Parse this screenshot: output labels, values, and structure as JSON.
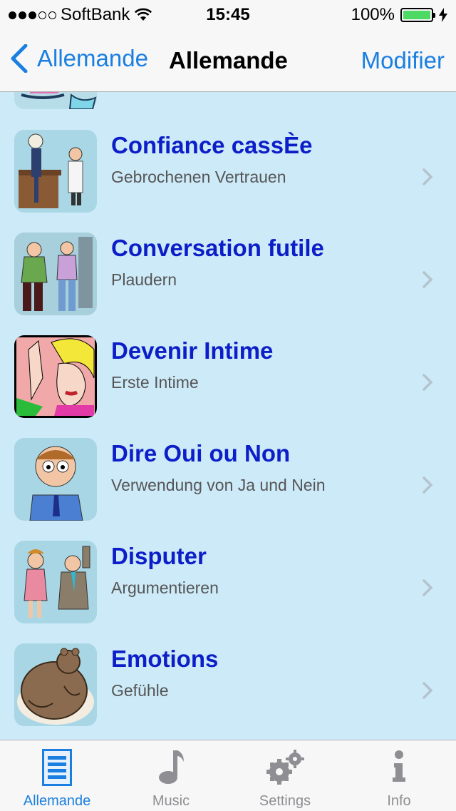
{
  "status_bar": {
    "carrier": "SoftBank",
    "time": "15:45",
    "battery": "100%"
  },
  "nav": {
    "back_label": "Allemande",
    "title": "Allemande",
    "edit_label": "Modifier"
  },
  "rows": [
    {
      "title": "Confiance cassÈe",
      "subtitle": "Gebrochenen Vertrauen",
      "icon": "skeleton-doctor-image"
    },
    {
      "title": "Conversation futile",
      "subtitle": "Plaudern",
      "icon": "chatting-people-image"
    },
    {
      "title": "Devenir Intime",
      "subtitle": "Erste Intime",
      "icon": "woman-face-image"
    },
    {
      "title": "Dire Oui ou Non",
      "subtitle": "Verwendung von Ja und Nein",
      "icon": "thinking-man-image"
    },
    {
      "title": "Disputer",
      "subtitle": "Argumentieren",
      "icon": "arguing-couple-image"
    },
    {
      "title": "Emotions",
      "subtitle": "Gefühle",
      "icon": "bear-image"
    }
  ],
  "tabs": [
    {
      "label": "Allemande",
      "icon": "list-icon",
      "active": true
    },
    {
      "label": "Music",
      "icon": "music-note-icon",
      "active": false
    },
    {
      "label": "Settings",
      "icon": "gears-icon",
      "active": false
    },
    {
      "label": "Info",
      "icon": "info-icon",
      "active": false
    }
  ],
  "colors": {
    "accent": "#1a7fe0",
    "row_title": "#0c1ec8",
    "list_background": "#cdeaf8"
  }
}
